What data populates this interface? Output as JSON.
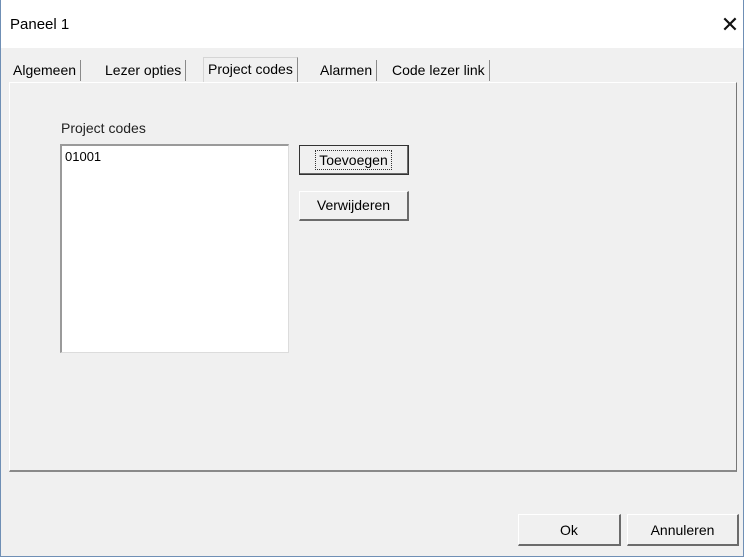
{
  "window": {
    "title": "Paneel 1"
  },
  "tabs": [
    {
      "label": "Algemeen"
    },
    {
      "label": "Lezer opties"
    },
    {
      "label": "Project codes"
    },
    {
      "label": "Alarmen"
    },
    {
      "label": "Code lezer link"
    }
  ],
  "active_tab": "Project codes",
  "project_codes": {
    "label": "Project codes",
    "items": [
      "01001"
    ],
    "add_button": "Toevoegen",
    "remove_button": "Verwijderen"
  },
  "footer": {
    "ok_button": "Ok",
    "cancel_button": "Annuleren"
  },
  "icons": {
    "close": "close-icon"
  }
}
